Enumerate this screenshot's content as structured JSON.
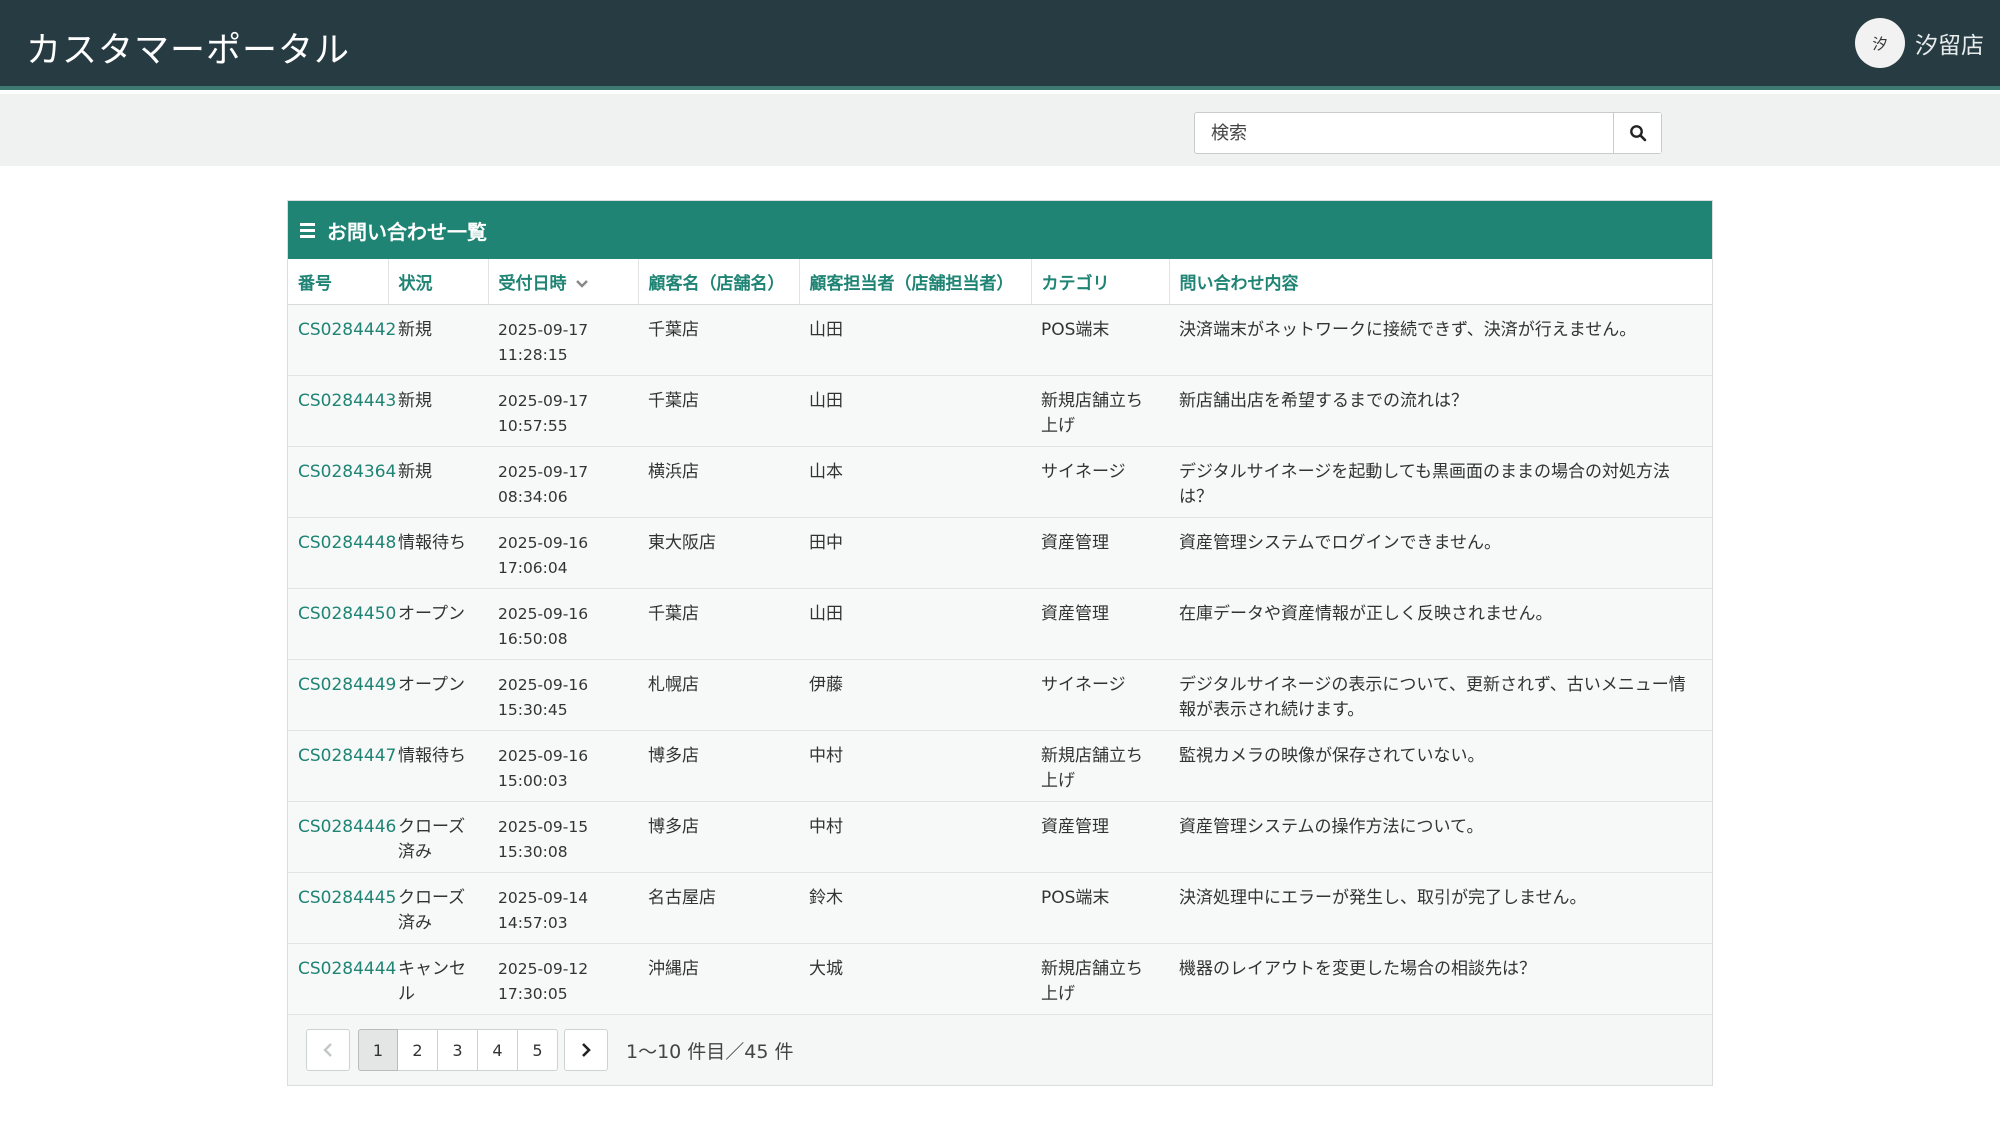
{
  "header": {
    "app_title": "カスタマーポータル",
    "user_initial": "汐",
    "user_name": "汐留店"
  },
  "search": {
    "placeholder": "検索"
  },
  "panel": {
    "title": "お問い合わせ一覧"
  },
  "table": {
    "columns": [
      "番号",
      "状況",
      "受付日時",
      "顧客名（店舗名）",
      "顧客担当者（店舗担当者）",
      "カテゴリ",
      "問い合わせ内容"
    ],
    "rows": [
      {
        "id": "CS0284442",
        "status": "新規",
        "date": "2025-09-17",
        "time": "11:28:15",
        "customer": "千葉店",
        "contact": "山田",
        "category": "POS端末",
        "content": "決済端末がネットワークに接続できず、決済が行えません。"
      },
      {
        "id": "CS0284443",
        "status": "新規",
        "date": "2025-09-17",
        "time": "10:57:55",
        "customer": "千葉店",
        "contact": "山田",
        "category": "新規店舗立ち上げ",
        "content": "新店舗出店を希望するまでの流れは？"
      },
      {
        "id": "CS0284364",
        "status": "新規",
        "date": "2025-09-17",
        "time": "08:34:06",
        "customer": "横浜店",
        "contact": "山本",
        "category": "サイネージ",
        "content": "デジタルサイネージを起動しても黒画面のままの場合の対処方法は？"
      },
      {
        "id": "CS0284448",
        "status": "情報待ち",
        "date": "2025-09-16",
        "time": "17:06:04",
        "customer": "東大阪店",
        "contact": "田中",
        "category": "資産管理",
        "content": "資産管理システムでログインできません。"
      },
      {
        "id": "CS0284450",
        "status": "オープン",
        "date": "2025-09-16",
        "time": "16:50:08",
        "customer": "千葉店",
        "contact": "山田",
        "category": "資産管理",
        "content": "在庫データや資産情報が正しく反映されません。"
      },
      {
        "id": "CS0284449",
        "status": "オープン",
        "date": "2025-09-16",
        "time": "15:30:45",
        "customer": "札幌店",
        "contact": "伊藤",
        "category": "サイネージ",
        "content": "デジタルサイネージの表示について、更新されず、古いメニュー情報が表示され続けます。"
      },
      {
        "id": "CS0284447",
        "status": "情報待ち",
        "date": "2025-09-16",
        "time": "15:00:03",
        "customer": "博多店",
        "contact": "中村",
        "category": "新規店舗立ち上げ",
        "content": "監視カメラの映像が保存されていない。"
      },
      {
        "id": "CS0284446",
        "status": "クローズ済み",
        "date": "2025-09-15",
        "time": "15:30:08",
        "customer": "博多店",
        "contact": "中村",
        "category": "資産管理",
        "content": "資産管理システムの操作方法について。"
      },
      {
        "id": "CS0284445",
        "status": "クローズ済み",
        "date": "2025-09-14",
        "time": "14:57:03",
        "customer": "名古屋店",
        "contact": "鈴木",
        "category": "POS端末",
        "content": "決済処理中にエラーが発生し、取引が完了しません。"
      },
      {
        "id": "CS0284444",
        "status": "キャンセル",
        "date": "2025-09-12",
        "time": "17:30:05",
        "customer": "沖縄店",
        "contact": "大城",
        "category": "新規店舗立ち上げ",
        "content": "機器のレイアウトを変更した場合の相談先は？"
      }
    ]
  },
  "pagination": {
    "pages": [
      "1",
      "2",
      "3",
      "4",
      "5"
    ],
    "current": "1",
    "summary": "1〜10 件目／45 件"
  },
  "colors": {
    "header_bg": "#263c42",
    "accent": "#1f8474"
  }
}
